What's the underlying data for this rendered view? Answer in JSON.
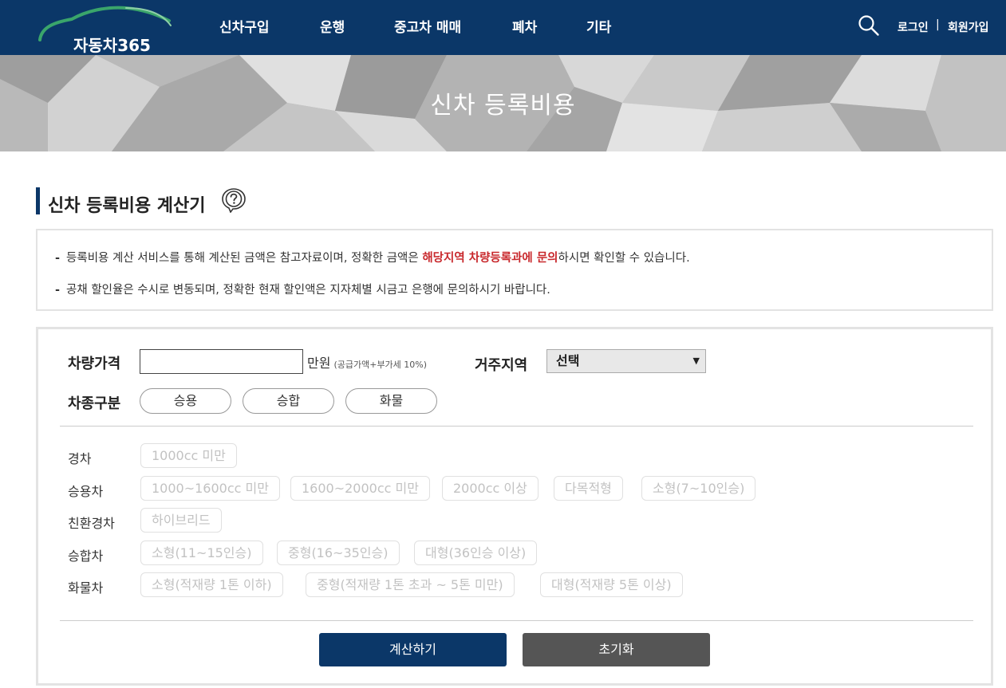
{
  "header": {
    "logo_text": "자동차365",
    "menu": [
      "신차구입",
      "운행",
      "중고차 매매",
      "폐차",
      "기타"
    ],
    "login": "로그인",
    "separator": "|",
    "signup": "회원가입"
  },
  "banner": {
    "title": "신차 등록비용"
  },
  "section": {
    "title": "신차 등록비용 계산기"
  },
  "notice": {
    "line1_before": "등록비용 계산 서비스를 통해 계산된 금액은 참고자료이며, 정확한 금액은 ",
    "line1_highlight": "해당지역 차량등록과에 문의",
    "line1_after": "하시면 확인할 수 있습니다.",
    "line2": "공채 할인율은 수시로 변동되며, 정확한 현재 할인액은 지자체별 시금고 은행에 문의하시기 바랍니다.",
    "dash": "-"
  },
  "form": {
    "price_label": "차량가격",
    "price_value": "",
    "unit": "만원",
    "unit_note": "(공급가액+부가세 10%)",
    "region_label": "거주지역",
    "region_selected": "선택",
    "type_label": "차종구분",
    "types": [
      "승용",
      "승합",
      "화물"
    ],
    "categories": [
      {
        "label": "경차",
        "options": [
          "1000cc 미만"
        ]
      },
      {
        "label": "승용차",
        "options": [
          "1000~1600cc 미만",
          "1600~2000cc 미만",
          "2000cc 이상",
          "다목적형",
          "소형(7~10인승)"
        ]
      },
      {
        "label": "친환경차",
        "options": [
          "하이브리드"
        ]
      },
      {
        "label": "승합차",
        "options": [
          "소형(11~15인승)",
          "중형(16~35인승)",
          "대형(36인승 이상)"
        ]
      },
      {
        "label": "화물차",
        "options": [
          "소형(적재량 1톤 이하)",
          "중형(적재량 1톤 초과 ~ 5톤 미만)",
          "대형(적재량 5톤 이상)"
        ]
      }
    ],
    "calc_button": "계산하기",
    "reset_button": "초기화"
  },
  "colors": {
    "navy": "#0b3768",
    "highlight_red": "#c8282c",
    "reset_gray": "#555555"
  },
  "icons": {
    "search": "search-icon",
    "help": "help-question-icon",
    "caret": "chevron-down-icon"
  }
}
